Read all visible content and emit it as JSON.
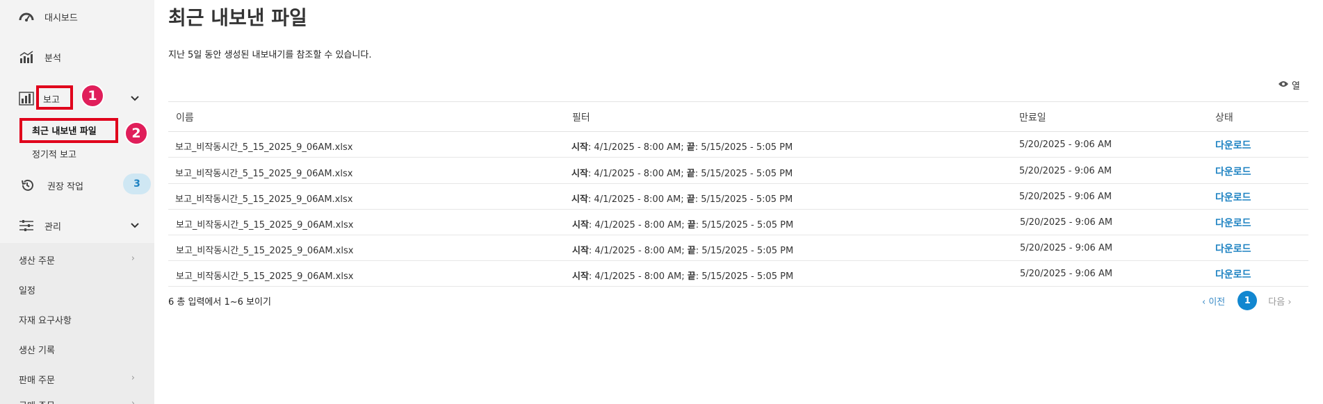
{
  "sidebar": {
    "dashboard": "대시보드",
    "analytics": "분석",
    "reports": "보고",
    "reports_sub": [
      "최근 내보낸 파일",
      "정기적 보고"
    ],
    "recommended": "권장 작업",
    "recommended_count": "3",
    "manage": "관리",
    "lower_items": [
      "생산 주문",
      "일정",
      "자재 요구사항",
      "생산 기록",
      "판매 주문",
      "구매 주문"
    ]
  },
  "annotations": {
    "step1": "1",
    "step2": "2"
  },
  "main": {
    "title": "최근 내보낸 파일",
    "subtitle": "지난 5일 동안 생성된 내보내기를 참조할 수 있습니다.",
    "columns_label": "열",
    "headers": [
      "이름",
      "필터",
      "만료일",
      "상태"
    ],
    "rows": [
      {
        "name": "보고_비작동시간_5_15_2025_9_06AM.xlsx",
        "start_label": "시작",
        "start": ": 4/1/2025 - 8:00 AM; ",
        "end_label": "끝",
        "end": ": 5/15/2025 - 5:05 PM",
        "expires": "5/20/2025 - 9:06 AM",
        "status": "다운로드"
      },
      {
        "name": "보고_비작동시간_5_15_2025_9_06AM.xlsx",
        "start_label": "시작",
        "start": ": 4/1/2025 - 8:00 AM; ",
        "end_label": "끝",
        "end": ": 5/15/2025 - 5:05 PM",
        "expires": "5/20/2025 - 9:06 AM",
        "status": "다운로드"
      },
      {
        "name": "보고_비작동시간_5_15_2025_9_06AM.xlsx",
        "start_label": "시작",
        "start": ": 4/1/2025 - 8:00 AM; ",
        "end_label": "끝",
        "end": ": 5/15/2025 - 5:05 PM",
        "expires": "5/20/2025 - 9:06 AM",
        "status": "다운로드"
      },
      {
        "name": "보고_비작동시간_5_15_2025_9_06AM.xlsx",
        "start_label": "시작",
        "start": ": 4/1/2025 - 8:00 AM; ",
        "end_label": "끝",
        "end": ": 5/15/2025 - 5:05 PM",
        "expires": "5/20/2025 - 9:06 AM",
        "status": "다운로드"
      },
      {
        "name": "보고_비작동시간_5_15_2025_9_06AM.xlsx",
        "start_label": "시작",
        "start": ": 4/1/2025 - 8:00 AM; ",
        "end_label": "끝",
        "end": ": 5/15/2025 - 5:05 PM",
        "expires": "5/20/2025 - 9:06 AM",
        "status": "다운로드"
      },
      {
        "name": "보고_비작동시간_5_15_2025_9_06AM.xlsx",
        "start_label": "시작",
        "start": ": 4/1/2025 - 8:00 AM; ",
        "end_label": "끝",
        "end": ": 5/15/2025 - 5:05 PM",
        "expires": "5/20/2025 - 9:06 AM",
        "status": "다운로드"
      }
    ],
    "footer_count": "6 총 입력에서 1~6 보이기",
    "pager": {
      "prev": "이전",
      "page": "1",
      "next": "다음"
    }
  },
  "colors": {
    "accent": "#1287d0",
    "annotation_red": "#e0001b",
    "step_badge": "#e01e5a",
    "sidebar_bg": "#f3f3f3"
  }
}
